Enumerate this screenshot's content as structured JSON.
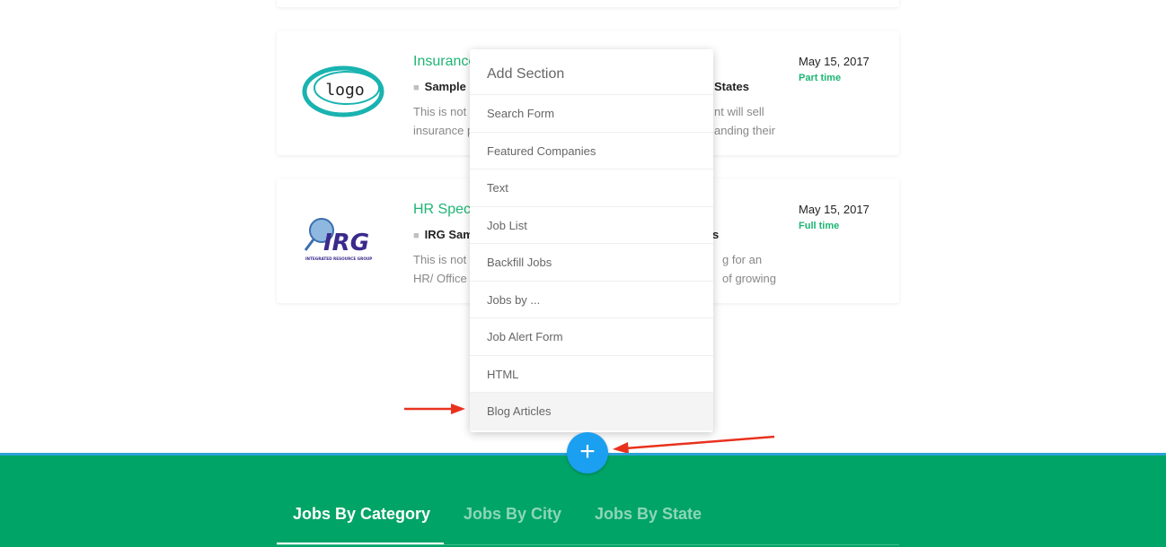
{
  "jobs": [
    {
      "title": "Insurance",
      "company": "Sample",
      "location": "States",
      "desc_left": [
        "This is not a",
        "insurance p"
      ],
      "desc_right": [
        "nt will sell",
        "anding their"
      ],
      "date": "May 15, 2017",
      "type": "Part time",
      "logo_text": "logo"
    },
    {
      "title": "HR Speci",
      "company": "IRG Sam",
      "location": "s",
      "desc_left": [
        "This is not a",
        "HR/ Office"
      ],
      "desc_right": [
        "g for an",
        "of growing"
      ],
      "date": "May 15, 2017",
      "type": "Full time",
      "logo_text": "IRG",
      "logo_subtext": "INTEGRATED RESOURCE GROUP"
    }
  ],
  "add_section_menu": {
    "title": "Add Section",
    "items": [
      "Search Form",
      "Featured Companies",
      "Text",
      "Job List",
      "Backfill Jobs",
      "Jobs by ...",
      "Job Alert Form",
      "HTML",
      "Blog Articles"
    ]
  },
  "add_button": {
    "label": "+"
  },
  "footer": {
    "tabs": [
      "Jobs By Category",
      "Jobs By City",
      "Jobs By State"
    ]
  },
  "colors": {
    "accent_green": "#1db573",
    "footer_green": "#00a466",
    "button_blue": "#1b9ff0",
    "annotation_red": "#e8321e"
  }
}
